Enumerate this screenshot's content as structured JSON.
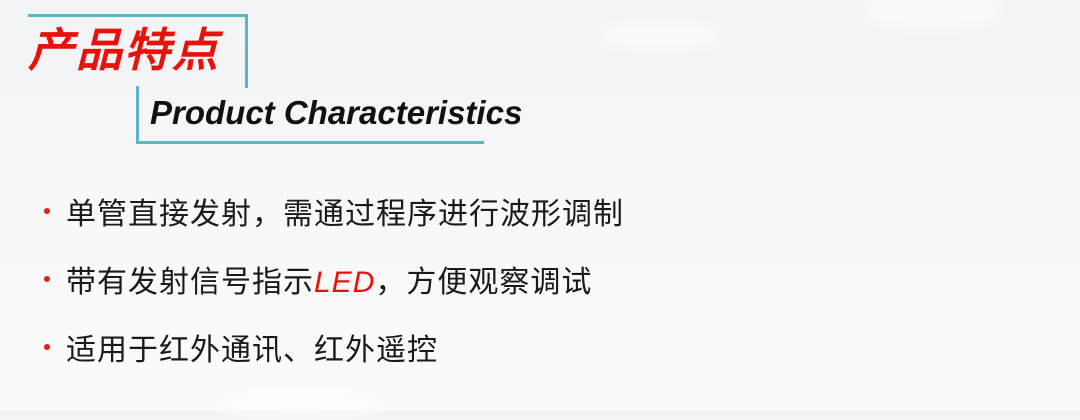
{
  "header": {
    "title_cn": "产品特点",
    "title_en": "Product Characteristics"
  },
  "bullets": [
    {
      "text": "单管直接发射，需通过程序进行波形调制"
    },
    {
      "pre": "带有发射信号指示",
      "highlight": "LED",
      "post": "，方便观察调试"
    },
    {
      "text": "适用于红外通讯、红外遥控"
    }
  ],
  "colors": {
    "title_red": "#e8120c",
    "frame_teal": "#5bb6c6",
    "bullet_red": "#d9241c",
    "text_dark": "#1a1a1a"
  }
}
